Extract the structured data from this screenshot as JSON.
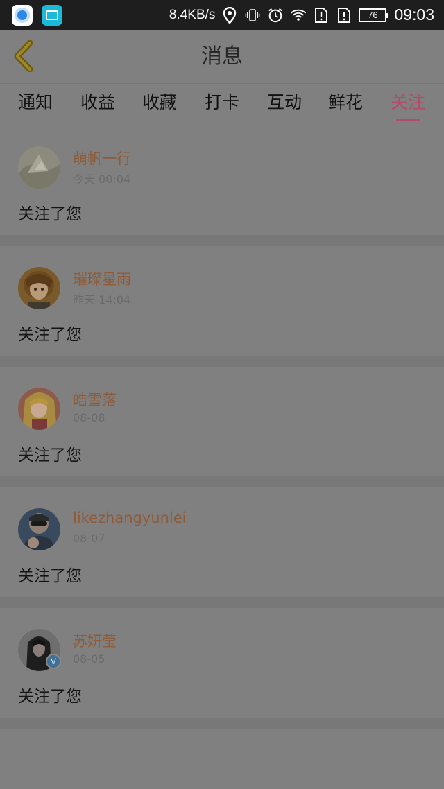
{
  "status_bar": {
    "net_speed": "8.4KB/s",
    "battery": "76",
    "time": "09:03",
    "icons": [
      "app-browser-icon",
      "gallery-icon",
      "location-icon",
      "vibrate-icon",
      "alarm-icon",
      "wifi-icon",
      "sim-alert-icon",
      "sim-alert-icon",
      "battery-icon"
    ]
  },
  "header": {
    "title": "消息",
    "back_icon": "chevron-left-icon"
  },
  "tabs": [
    {
      "label": "通知"
    },
    {
      "label": "收益"
    },
    {
      "label": "收藏"
    },
    {
      "label": "打卡"
    },
    {
      "label": "互动"
    },
    {
      "label": "鲜花"
    },
    {
      "label": "关注",
      "active": true
    }
  ],
  "items": [
    {
      "name": "萌帆一行",
      "time": "今天 00:04",
      "message": "关注了您",
      "avatar": "avatar-landscape"
    },
    {
      "name": "璀璨星雨",
      "time": "昨天 14:04",
      "message": "关注了您",
      "avatar": "avatar-anime-girl"
    },
    {
      "name": "皓雪落",
      "time": "08-08",
      "message": "关注了您",
      "avatar": "avatar-anime-blonde"
    },
    {
      "name": "likezhangyunlei",
      "time": "08-07",
      "message": "关注了您",
      "avatar": "avatar-photo-man"
    },
    {
      "name": "苏妍莹",
      "time": "08-05",
      "message": "关注了您",
      "avatar": "avatar-photo-woman",
      "verified_badge": "V"
    }
  ],
  "colors": {
    "accent": "#b24a6a",
    "username": "#8e5a38",
    "overlay_bg": "#808080"
  }
}
